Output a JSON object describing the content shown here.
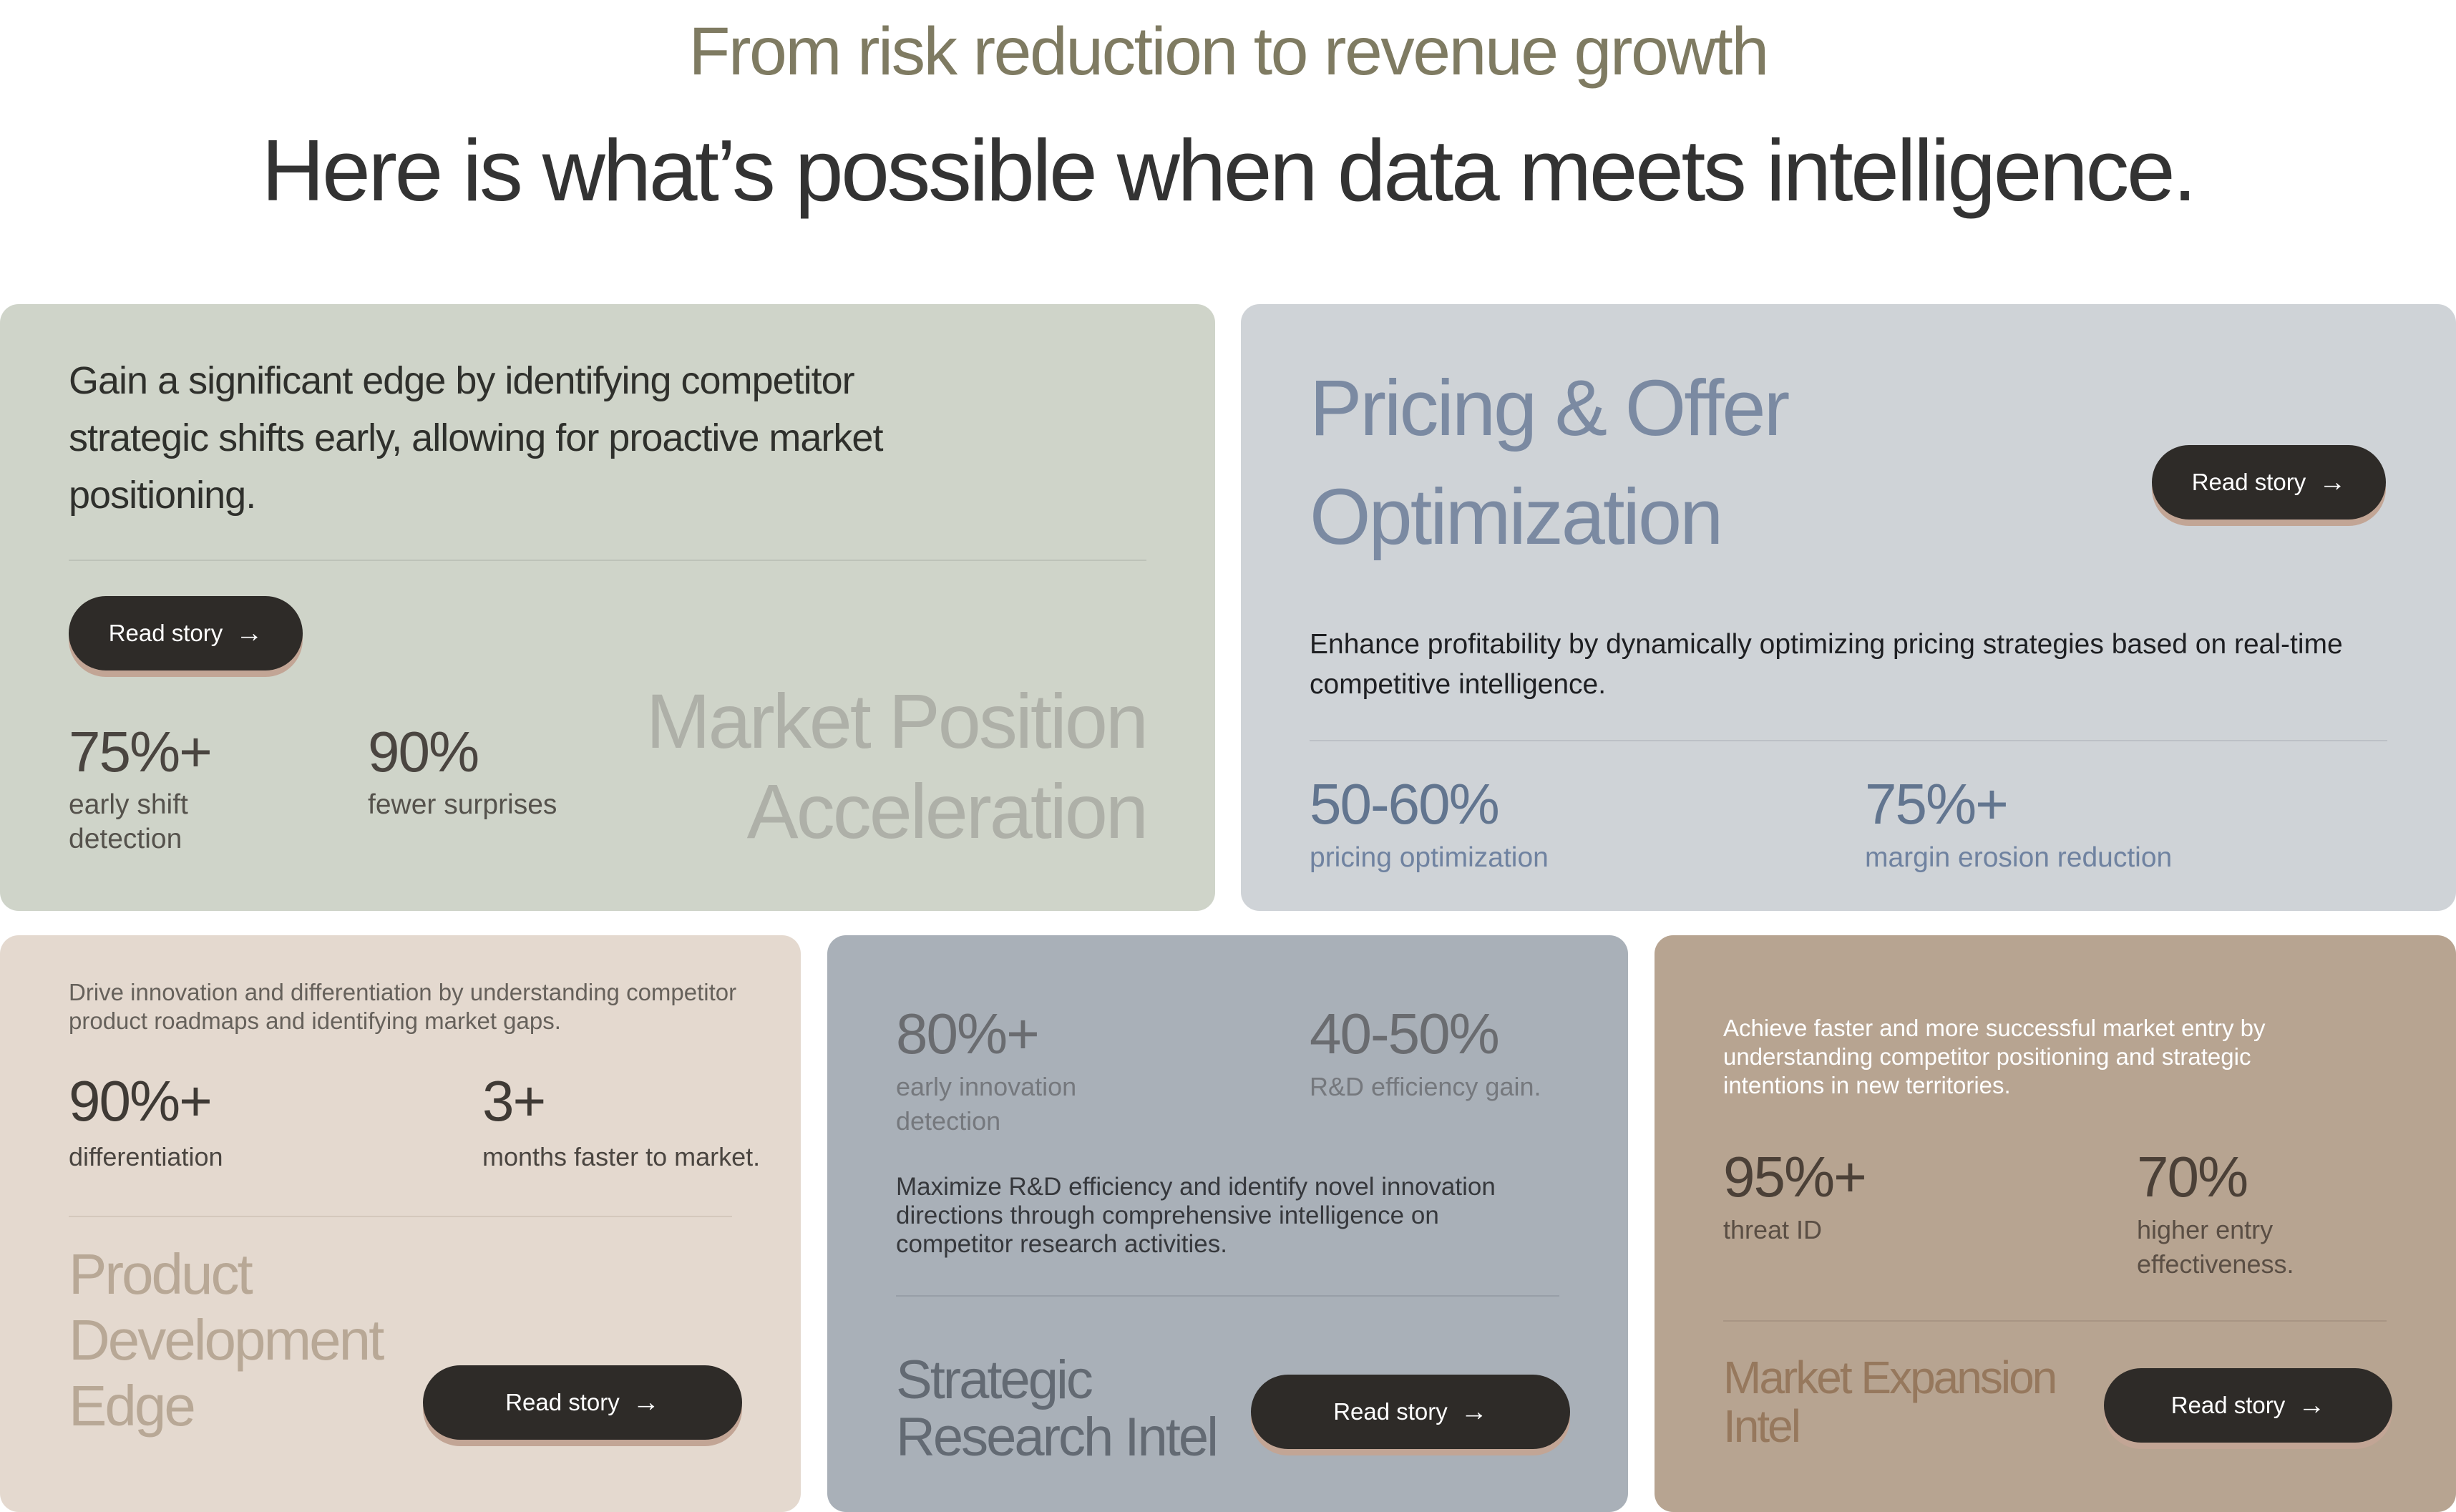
{
  "header": {
    "eyebrow": "From risk reduction to revenue growth",
    "headline": "Here is what’s possible when data meets intelligence."
  },
  "cards": {
    "market_position": {
      "description": "Gain a significant edge by identifying competitor strategic shifts early, allowing for proactive market positioning.",
      "button": "Read story",
      "stats": [
        {
          "value": "75%+",
          "label": "early shift detection"
        },
        {
          "value": "90%",
          "label": "fewer surprises"
        }
      ],
      "title_line1": "Market Position",
      "title_line2": "Acceleration"
    },
    "pricing": {
      "title_line1": "Pricing & Offer",
      "title_line2": "Optimization",
      "button": "Read story",
      "description": "Enhance profitability by dynamically optimizing pricing strategies based on real-time competitive intelligence.",
      "stats": [
        {
          "value": "50-60%",
          "label": "pricing optimization"
        },
        {
          "value": "75%+",
          "label": "margin erosion reduction"
        }
      ]
    },
    "product": {
      "description": "Drive innovation and differentiation by understanding competitor product roadmaps and identifying market gaps.",
      "stats": [
        {
          "value": "90%+",
          "label": "differentiation"
        },
        {
          "value": "3+",
          "label": "months faster to market."
        }
      ],
      "title_line1": "Product",
      "title_line2": "Development",
      "title_line3": "Edge",
      "button": "Read story"
    },
    "research": {
      "stats": [
        {
          "value": "80%+",
          "label": "early innovation detection"
        },
        {
          "value": "40-50%",
          "label": "R&D efficiency gain."
        }
      ],
      "description": "Maximize R&D efficiency and identify novel innovation directions through comprehensive intelligence on competitor research activities.",
      "title_line1": "Strategic",
      "title_line2": "Research Intel",
      "button": "Read story"
    },
    "expansion": {
      "description": "Achieve faster and more successful market entry by understanding competitor positioning and strategic intentions in new territories.",
      "stats": [
        {
          "value": "95%+",
          "label": "threat ID"
        },
        {
          "value": "70%",
          "label": "higher entry effectiveness."
        }
      ],
      "title_line1": "Market Expansion",
      "title_line2": "Intel",
      "button": "Read story"
    }
  },
  "icons": {
    "arrow": "arrow-right-icon"
  },
  "colors": {
    "sage": "#cfd4c9",
    "slate_light": "#cfd3d7",
    "beige": "#e4d9cf",
    "slate": "#a9b0b8",
    "taupe": "#b7a491",
    "button": "#2e2b28",
    "button_shadow": "#c2a595"
  }
}
